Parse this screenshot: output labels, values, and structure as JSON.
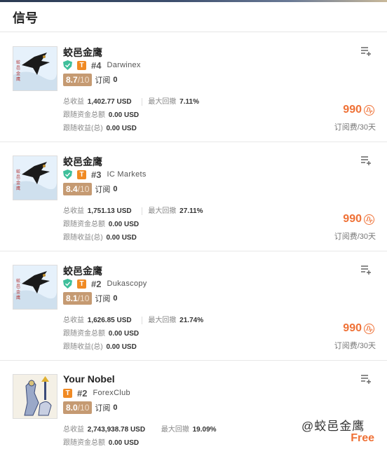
{
  "header": {
    "title": "信号"
  },
  "signals": [
    {
      "name": "蛟邑金鹰",
      "verified": true,
      "rank": "#4",
      "broker": "Darwinex",
      "score": "8.7",
      "score_max": "/10",
      "subs_label": "订阅",
      "subs_count": "0",
      "profit_label": "总收益",
      "profit": "1,402.77 USD",
      "drawdown_label": "最大回撤",
      "drawdown": "7.11%",
      "follow_funds_label": "跟随资金总额",
      "follow_funds": "0.00 USD",
      "follow_profit_label": "跟随收益(总)",
      "follow_profit": "0.00 USD",
      "price": "990",
      "period": "订阅费/30天"
    },
    {
      "name": "蛟邑金鹰",
      "verified": true,
      "rank": "#3",
      "broker": "IC Markets",
      "score": "8.4",
      "score_max": "/10",
      "subs_label": "订阅",
      "subs_count": "0",
      "profit_label": "总收益",
      "profit": "1,751.13 USD",
      "drawdown_label": "最大回撤",
      "drawdown": "27.11%",
      "follow_funds_label": "跟随资金总额",
      "follow_funds": "0.00 USD",
      "follow_profit_label": "跟随收益(总)",
      "follow_profit": "0.00 USD",
      "price": "990",
      "period": "订阅费/30天"
    },
    {
      "name": "蛟邑金鹰",
      "verified": true,
      "rank": "#2",
      "broker": "Dukascopy",
      "score": "8.1",
      "score_max": "/10",
      "subs_label": "订阅",
      "subs_count": "0",
      "profit_label": "总收益",
      "profit": "1,626.85 USD",
      "drawdown_label": "最大回撤",
      "drawdown": "21.74%",
      "follow_funds_label": "跟随资金总额",
      "follow_funds": "0.00 USD",
      "follow_profit_label": "跟随收益(总)",
      "follow_profit": "0.00 USD",
      "price": "990",
      "period": "订阅费/30天"
    },
    {
      "name": "Your Nobel",
      "verified": false,
      "rank": "#2",
      "broker": "ForexClub",
      "score": "8.0",
      "score_max": "/10",
      "subs_label": "订阅",
      "subs_count": "0",
      "profit_label": "总收益",
      "profit": "2,743,938.78 USD",
      "drawdown_label": "最大回撤",
      "drawdown": "19.09%",
      "follow_funds_label": "跟随资金总额",
      "follow_funds": "0.00 USD",
      "price": "Free"
    }
  ],
  "tier_badge": "T",
  "coin_symbol": "₯",
  "watermark": "@蛟邑金鹰",
  "colors": {
    "accent": "#ef7136",
    "score_bg": "#c59a72",
    "verified": "#3fbf9b",
    "tier": "#f08a24"
  }
}
